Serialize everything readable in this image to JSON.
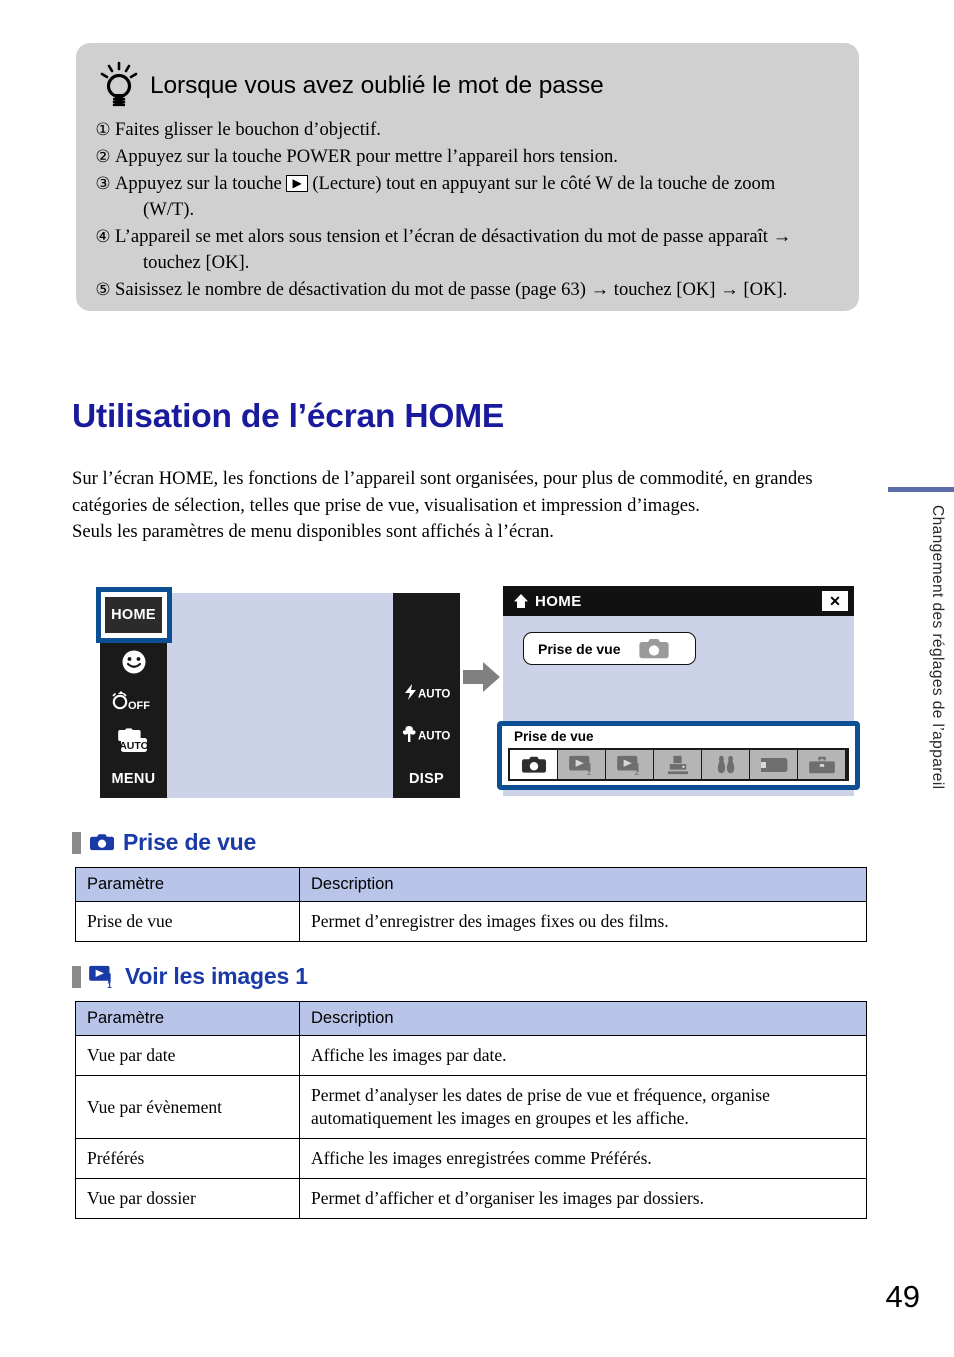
{
  "tip": {
    "icon": "lightbulb-icon",
    "title": "Lorsque vous avez oublié le mot de passe",
    "items": [
      {
        "num": "①",
        "text": "Faites glisser le bouchon d’objectif."
      },
      {
        "num": "②",
        "text": "Appuyez sur la touche POWER pour mettre l’appareil hors tension."
      },
      {
        "num": "③",
        "pre": "Appuyez sur la touche",
        "glyph": "▶",
        "post": "(Lecture) tout en appuyant sur le côté W de la touche de zoom",
        "cont": "(W/T)."
      },
      {
        "num": "④",
        "text": "L’appareil se met alors sous tension et l’écran de désactivation du mot de passe apparaît →",
        "cont": "touchez [OK]."
      },
      {
        "num": "⑤",
        "text": "Saisissez le nombre de désactivation du mot de passe (page 63) → touchez [OK] → [OK]."
      }
    ]
  },
  "heading": {
    "title": "Utilisation de l’écran HOME"
  },
  "intro": {
    "p1": "Sur l’écran HOME, les fonctions de l’appareil sont organisées, pour plus de commodité, en grandes catégories de sélection, telles que prise de vue, visualisation et impression d’images.",
    "p2": "Seuls les paramètres de menu disponibles sont affichés à l’écran."
  },
  "sidetab": {
    "text": "Changement des réglages de l’appareil",
    "color": "#5b6ea8"
  },
  "figure": {
    "left_screen": {
      "home_button": "HOME",
      "left_icons": [
        {
          "name": "smile-shutter-icon",
          "label": ""
        },
        {
          "name": "self-timer-off-icon",
          "label": "OFF"
        },
        {
          "name": "auto-mode-icon",
          "label": "AUTO"
        },
        {
          "name": "menu-label",
          "label": "MENU"
        }
      ],
      "right_icons": [
        {
          "name": "flash-auto-icon",
          "label": "AUTO"
        },
        {
          "name": "macro-auto-icon",
          "label": "AUTO"
        },
        {
          "name": "disp-label",
          "label": "DISP"
        }
      ]
    },
    "arrow": "arrow-right-icon",
    "right_screen": {
      "title": "HOME",
      "close": "✕",
      "menu_button": "Prise de vue",
      "category_title": "Prise de vue",
      "categories": [
        {
          "name": "shooting-category-icon",
          "selected": true
        },
        {
          "name": "view-images-1-category-icon",
          "selected": false
        },
        {
          "name": "view-images-2-category-icon",
          "selected": false
        },
        {
          "name": "print-category-icon",
          "selected": false
        },
        {
          "name": "manage-memory-category-icon",
          "selected": false
        },
        {
          "name": "memory-card-category-icon",
          "selected": false
        },
        {
          "name": "settings-toolbox-category-icon",
          "selected": false
        }
      ]
    }
  },
  "section1": {
    "icon": "camera-icon",
    "title": "Prise de vue",
    "table": {
      "headers": [
        "Paramètre",
        "Description"
      ],
      "rows": [
        [
          "Prise de vue",
          "Permet d’enregistrer des images fixes ou des films."
        ]
      ]
    }
  },
  "section2": {
    "icon": "view-images-1-icon",
    "title": "Voir les images 1",
    "table": {
      "headers": [
        "Paramètre",
        "Description"
      ],
      "rows": [
        [
          "Vue par date",
          "Affiche les images par date."
        ],
        [
          "Vue par évènement",
          "Permet d’analyser les dates de prise de vue et fréquence, organise automatiquement les images en groupes et les affiche."
        ],
        [
          "Préférés",
          "Affiche les images enregistrées comme Préférés."
        ],
        [
          "Vue par dossier",
          "Permet d’afficher et d’organiser les images par dossiers."
        ]
      ]
    }
  },
  "footer": {
    "page_number": "49"
  }
}
